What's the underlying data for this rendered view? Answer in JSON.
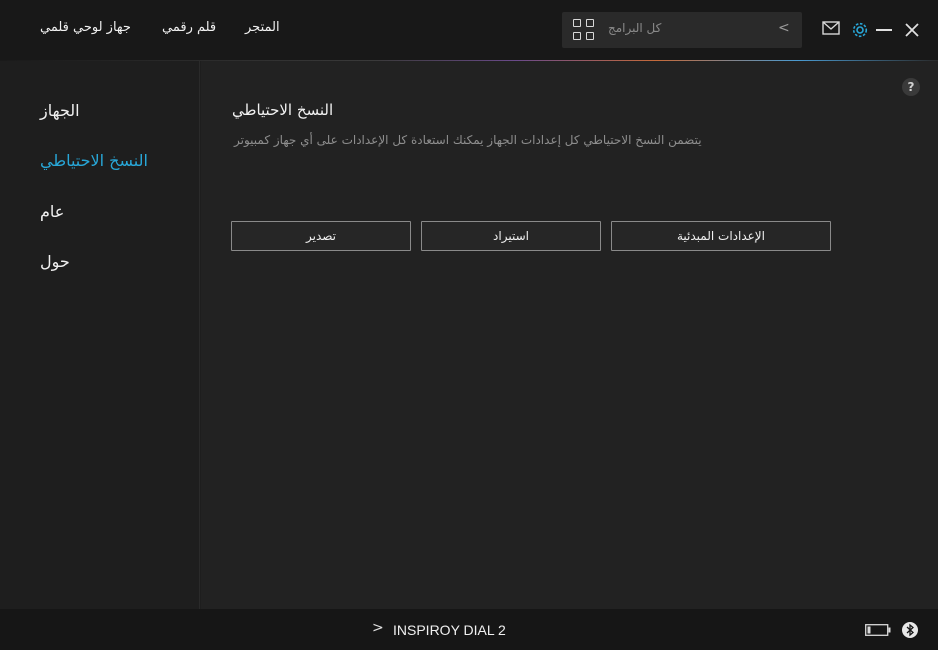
{
  "nav": {
    "tab_device": "جهاز لوحي قلمي",
    "tab_pen": "قلم رقمي",
    "tab_store": "المتجر"
  },
  "search": {
    "label": "كل البرامج",
    "chevron": "<"
  },
  "window_icons": [
    "mail-icon",
    "gear-icon",
    "minimize-icon",
    "close-icon"
  ],
  "colors": {
    "accent": "#28a7d8",
    "background": "#1e1e1e",
    "topbar": "#181818"
  },
  "sidebar": {
    "items": [
      {
        "label": "الجهاز",
        "active": false
      },
      {
        "label": "النسخ الاحتياطي",
        "active": true
      },
      {
        "label": "عام",
        "active": false
      },
      {
        "label": "حول",
        "active": false
      }
    ]
  },
  "help": {
    "label": "?"
  },
  "backup": {
    "title": "النسخ الاحتياطي",
    "description": "يتضمن النسخ الاحتياطي كل إعدادات الجهاز يمكنك استعادة كل الإعدادات على أي جهاز كمبيوتر",
    "buttons": {
      "export": "تصدير",
      "import": "استيراد",
      "defaults": "الإعدادات المبدئية"
    }
  },
  "footer": {
    "device_name": "INSPIROY DIAL 2",
    "chevron": ">",
    "icons": [
      "battery-icon",
      "bluetooth-icon"
    ]
  }
}
